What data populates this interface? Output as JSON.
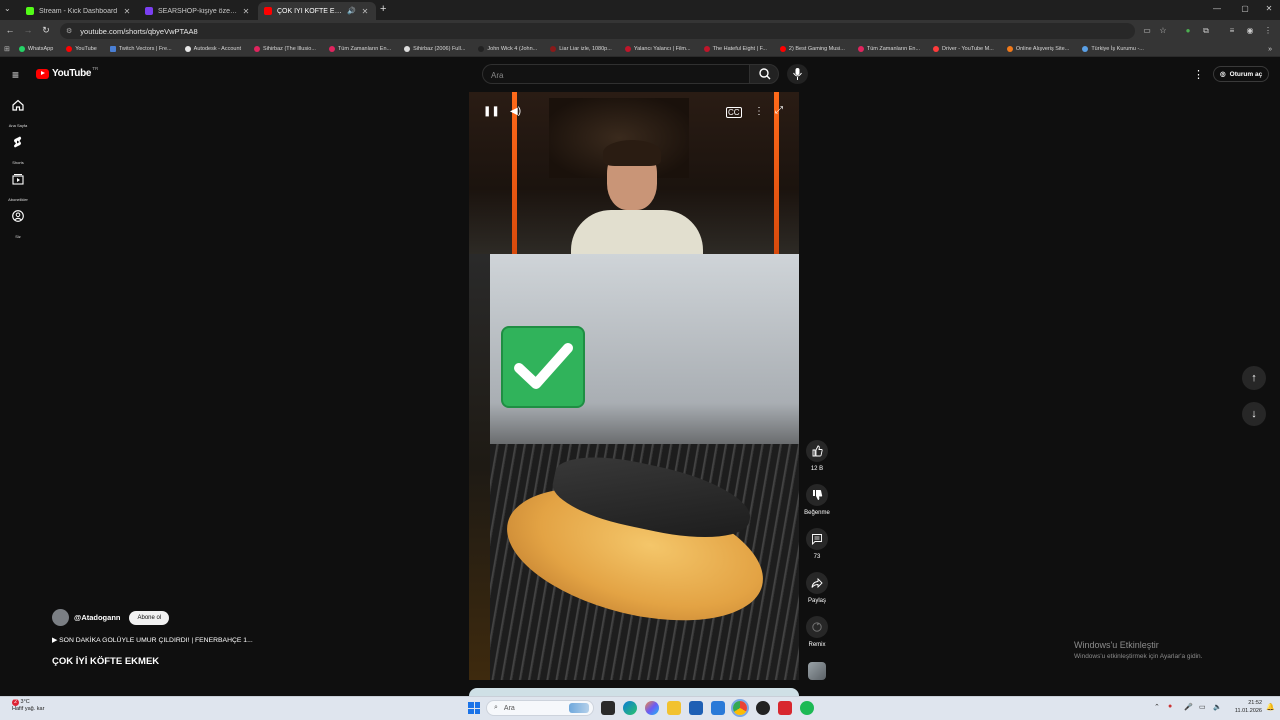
{
  "browser": {
    "tabs": [
      {
        "title": "Stream - Kick Dashboard",
        "favicon_color": "#53fc18",
        "active": false
      },
      {
        "title": "SEARSHOP-kişiye özel baladan",
        "favicon_color": "#7b3ff2",
        "active": false
      },
      {
        "title": "ÇOK İYİ KÖFTE EKMEK - Yo",
        "favicon_color": "#ff0000",
        "active": true
      }
    ],
    "url": "youtube.com/shorts/qbyeVwPTAA8",
    "bookmarks": [
      {
        "label": "WhatsApp",
        "color": "#25d366"
      },
      {
        "label": "YouTube",
        "color": "#ff0000"
      },
      {
        "label": "Twitch Vectors | Fre...",
        "color": "#4a7fd4"
      },
      {
        "label": "Autodesk - Account",
        "color": "#e8e8e8"
      },
      {
        "label": "Sihirbaz (The Illusio...",
        "color": "#e0245e"
      },
      {
        "label": "Tüm Zamanların En...",
        "color": "#e0245e"
      },
      {
        "label": "Sihirbaz (2006) Full...",
        "color": "#dddddd"
      },
      {
        "label": "John Wick 4 (John...",
        "color": "#222222"
      },
      {
        "label": "Liar Liar izle, 1080p...",
        "color": "#8a1a1a"
      },
      {
        "label": "Yalancı Yalancı | Film...",
        "color": "#c0152a"
      },
      {
        "label": "The Hateful Eight | F...",
        "color": "#c0152a"
      },
      {
        "label": "2) Best Gaming Musi...",
        "color": "#ff0000"
      },
      {
        "label": "Tüm Zamanların En...",
        "color": "#e0245e"
      },
      {
        "label": "Driver - YouTube M...",
        "color": "#ff3b3b"
      },
      {
        "label": "Online Alışveriş Site...",
        "color": "#f27a1a"
      },
      {
        "label": "Türkiye İş Kurumu -...",
        "color": "#5aa0e6"
      }
    ]
  },
  "youtube": {
    "logo_text": "YouTube",
    "country_code": "TR",
    "search_placeholder": "Ara",
    "signin_label": "Oturum aç",
    "sidenav": [
      {
        "label": "Ana Sayfa",
        "icon": "home-icon"
      },
      {
        "label": "Shorts",
        "icon": "shorts-icon"
      },
      {
        "label": "Abonelikler",
        "icon": "subscriptions-icon"
      },
      {
        "label": "Siz",
        "icon": "account-icon"
      }
    ],
    "actions": {
      "like_count": "12 B",
      "dislike_label": "Beğenme",
      "comment_count": "73",
      "share_label": "Paylaş",
      "remix_label": "Remix"
    },
    "channel_name": "@Atadogann",
    "subscribe_label": "Abone ol",
    "suggested_video": "SON DAKİKA GOLÜYLE UMUR ÇILDIRDI! | FENERBAHÇE 1...",
    "video_title": "ÇOK İYİ KÖFTE EKMEK"
  },
  "watermark": {
    "title": "Windows'u Etkinleştir",
    "subtitle": "Windows'u etkinleştirmek için Ayarlar'a gidin."
  },
  "taskbar": {
    "weather_temp": "3°C",
    "weather_desc": "Hafif yağ. kar",
    "weather_badge": "2",
    "search_placeholder": "Ara",
    "time": "21:52",
    "date": "11.01.2026"
  }
}
